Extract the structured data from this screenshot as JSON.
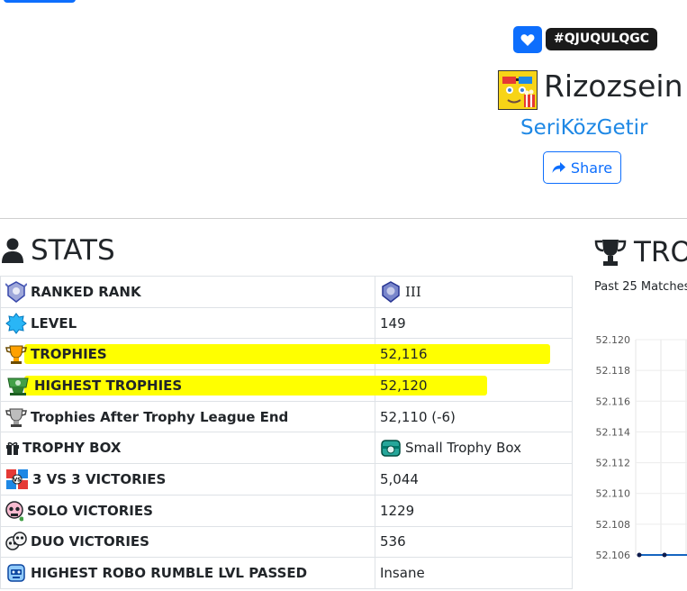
{
  "profile": {
    "tag": "#QJUQULQGC",
    "name": "Rizozsein",
    "club": "SeriKözGetir",
    "share_label": "Share"
  },
  "colors": {
    "accent": "#0d6efd",
    "club_link": "#1e88e5",
    "highlight": "#ffff00",
    "badge_bg": "#1a1a1a"
  },
  "stats": {
    "title": "STATS",
    "rows": [
      {
        "label": "RANKED RANK",
        "value": "III",
        "icon": "ranked-rank-icon"
      },
      {
        "label": "LEVEL",
        "value": "149",
        "icon": "level-icon"
      },
      {
        "label": "TROPHIES",
        "value": "52,116",
        "icon": "trophies-icon",
        "highlighted": true
      },
      {
        "label": "HIGHEST TROPHIES",
        "value": "52,120",
        "icon": "highest-trophies-icon",
        "highlighted": true
      },
      {
        "label": "Trophies After Trophy League End",
        "value": "52,110 (-6)",
        "icon": "trophy-league-icon"
      },
      {
        "label": "TROPHY BOX",
        "value": "Small Trophy Box",
        "icon": "gift-icon"
      },
      {
        "label": "3 VS 3 VICTORIES",
        "value": "5,044",
        "icon": "3v3-icon"
      },
      {
        "label": "SOLO VICTORIES",
        "value": "1229",
        "icon": "solo-icon"
      },
      {
        "label": "DUO VICTORIES",
        "value": "536",
        "icon": "duo-icon"
      },
      {
        "label": "HIGHEST ROBO RUMBLE LVL PASSED",
        "value": "Insane",
        "icon": "robo-rumble-icon"
      }
    ]
  },
  "trophy_panel": {
    "title": "TRO",
    "subtitle": "Past 25 Matches"
  },
  "chart_data": {
    "type": "line",
    "ylim": [
      52.106,
      52.12
    ],
    "yticks": [
      "52.120",
      "52.118",
      "52.116",
      "52.114",
      "52.112",
      "52.110",
      "52.108",
      "52.106"
    ],
    "series": [
      {
        "values": [
          52.106,
          52.106,
          52.106
        ]
      }
    ],
    "grid": true,
    "line_color": "#1565c0"
  }
}
